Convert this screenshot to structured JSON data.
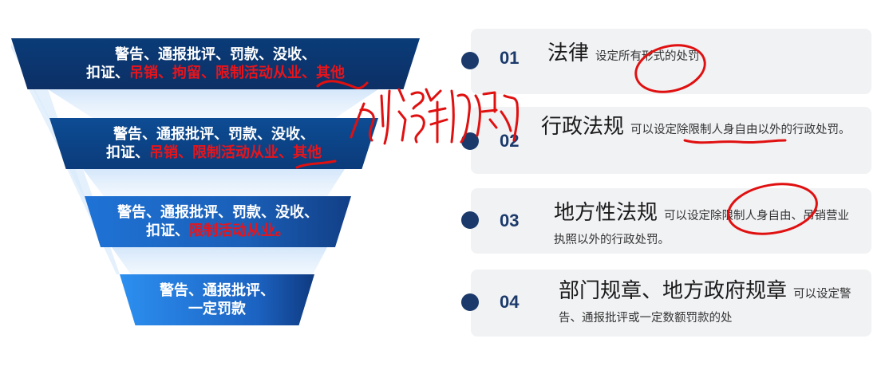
{
  "funnel": {
    "tiers": [
      {
        "line1": "警告、通报批评、罚款、没收、",
        "line2_black": "扣证、",
        "line2_red": "吊销、拘留、限制活动从业、其他"
      },
      {
        "line1": "警告、通报批评、罚款、没收、",
        "line2_black": "扣证、",
        "line2_red": "吊销、限制活动从业、其他"
      },
      {
        "line1": "警告、通报批评、罚款、没收、",
        "line2_black": "扣证、",
        "line2_red": "限制活动从业。"
      },
      {
        "line1": "警告、通报批评、",
        "line2_black": "一定罚款",
        "line2_red": ""
      }
    ]
  },
  "levels": [
    {
      "number": "01",
      "title": "法律",
      "desc": "设定所有形式的处罚"
    },
    {
      "number": "02",
      "title": "行政法规",
      "desc": "可以设定除限制人身自由以外的行政处罚。"
    },
    {
      "number": "03",
      "title": "地方性法规",
      "desc": "可以设定除限制人身自由、吊销营业执照以外的行政处罚。"
    },
    {
      "number": "04",
      "title": "部门规章、地方政府规章",
      "desc": "可以设定警告、通报批评或一定数额罚款的处"
    }
  ],
  "colors": {
    "dark_navy": "#0d2f66",
    "bright_blue": "#2c8ff0",
    "penalty_red": "#e8141b",
    "ink_red": "#e01010",
    "number_navy": "#1b3a6b",
    "card_gray": "#f1f2f4"
  },
  "handwritten_note": "创设新的"
}
